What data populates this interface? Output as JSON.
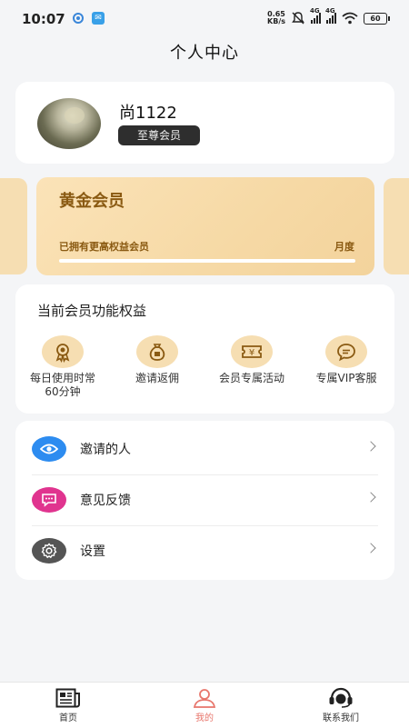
{
  "status_bar": {
    "time": "10:07",
    "net_speed_value": "0.65",
    "net_speed_unit": "KB/s",
    "signal_label_1": "4G",
    "signal_label_2": "4G",
    "battery": "60"
  },
  "header": {
    "title": "个人中心"
  },
  "profile": {
    "username": "尚1122",
    "level_badge": "至尊会员"
  },
  "membership": {
    "card_title": "黄金会员",
    "card_subtitle": "已拥有更高权益会员",
    "card_period": "月度",
    "progress": 1.0,
    "colors": {
      "card": "#f6d9a5",
      "text": "#8a5a12"
    }
  },
  "benefits": {
    "title": "当前会员功能权益",
    "items": [
      {
        "label_line1": "每日使用时常",
        "label_line2": "60分钟",
        "icon": "medal-icon"
      },
      {
        "label_line1": "邀请返佣",
        "label_line2": "",
        "icon": "money-bag-icon"
      },
      {
        "label_line1": "会员专属活动",
        "label_line2": "",
        "icon": "ticket-icon"
      },
      {
        "label_line1": "专属VIP客服",
        "label_line2": "",
        "icon": "chat-bubble-icon"
      }
    ]
  },
  "menu": {
    "items": [
      {
        "label": "邀请的人",
        "icon": "eye-icon",
        "color": "#2d8cf0"
      },
      {
        "label": "意见反馈",
        "icon": "message-icon",
        "color": "#e0348f"
      },
      {
        "label": "设置",
        "icon": "gear-icon",
        "color": "#555555"
      }
    ]
  },
  "bottom_nav": {
    "items": [
      {
        "label": "首页",
        "icon": "newspaper-icon",
        "active": false
      },
      {
        "label": "我的",
        "icon": "person-icon",
        "active": true
      },
      {
        "label": "联系我们",
        "icon": "headset-icon",
        "active": false
      }
    ],
    "active_color": "#e8766c"
  }
}
